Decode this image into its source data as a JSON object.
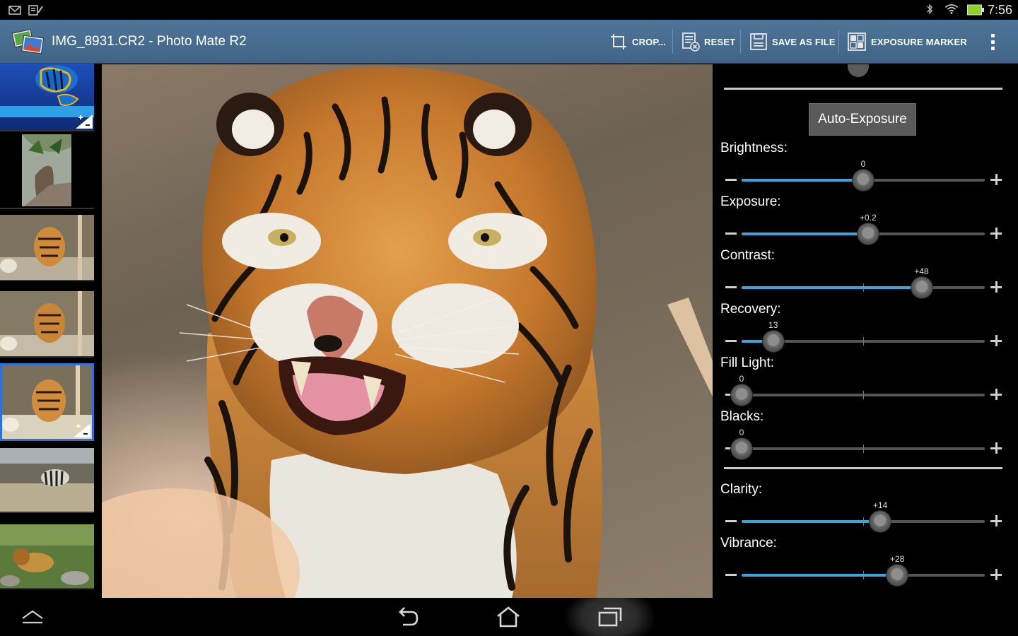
{
  "status_bar": {
    "time": "7:56",
    "left_icons": [
      "mail-icon",
      "clipboard-icon"
    ],
    "right_icons": [
      "bluetooth-icon",
      "wifi-icon",
      "battery-icon"
    ]
  },
  "action_bar": {
    "title": "IMG_8931.CR2 - Photo Mate R2",
    "buttons": [
      {
        "label": "CROP...",
        "icon": "crop-icon"
      },
      {
        "label": "RESET",
        "icon": "reset-icon"
      },
      {
        "label": "SAVE AS FILE",
        "icon": "save-icon"
      },
      {
        "label": "EXPOSURE MARKER",
        "icon": "exposure-marker-icon"
      }
    ],
    "overflow_icon": "overflow-menu-icon"
  },
  "filmstrip": {
    "thumbnails": [
      {
        "subject": "fish",
        "selected": false,
        "has_badge": true
      },
      {
        "subject": "bird",
        "selected": false,
        "has_badge": false
      },
      {
        "subject": "tiger",
        "selected": false,
        "has_badge": false
      },
      {
        "subject": "tiger",
        "selected": false,
        "has_badge": false
      },
      {
        "subject": "tiger",
        "selected": true,
        "has_badge": true
      },
      {
        "subject": "zebra",
        "selected": false,
        "has_badge": false
      },
      {
        "subject": "lion",
        "selected": false,
        "has_badge": false
      }
    ]
  },
  "panel": {
    "auto_exposure_label": "Auto-Exposure",
    "controls": [
      {
        "label": "Brightness:",
        "value": "0",
        "position": 0.5,
        "fill_from": 0.0
      },
      {
        "label": "Exposure:",
        "value": "+0.2",
        "position": 0.52,
        "fill_from": 0.0
      },
      {
        "label": "Contrast:",
        "value": "+48",
        "position": 0.74,
        "fill_from": 0.0
      },
      {
        "label": "Recovery:",
        "value": "13",
        "position": 0.13,
        "fill_from": 0.0
      },
      {
        "label": "Fill Light:",
        "value": "0",
        "position": 0.0,
        "fill_from": 0.0
      },
      {
        "label": "Blacks:",
        "value": "0",
        "position": 0.0,
        "fill_from": 0.0
      },
      {
        "label": "Clarity:",
        "value": "+14",
        "position": 0.57,
        "fill_from": 0.0
      },
      {
        "label": "Vibrance:",
        "value": "+28",
        "position": 0.64,
        "fill_from": 0.0
      }
    ]
  },
  "nav_bar": {
    "icons": [
      "collapse-up-icon",
      "back-icon",
      "home-icon",
      "recent-apps-icon"
    ]
  },
  "colors": {
    "action_bar": "#46698c",
    "slider_fill": "#3ea2db",
    "selected_thumb_border": "#2f6fd6"
  }
}
